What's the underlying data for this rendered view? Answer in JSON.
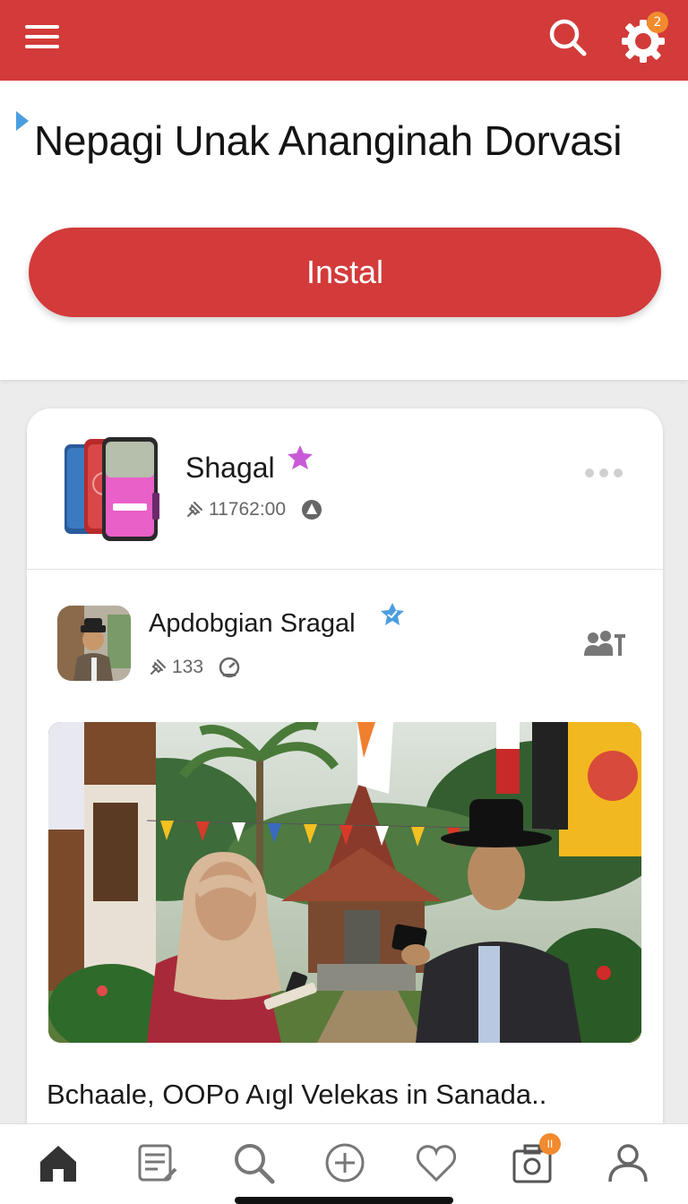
{
  "header": {
    "title": "Nepagi Unak Ananginah Dorvasi",
    "install_label": "Instal",
    "settings_badge": "2"
  },
  "app": {
    "name": "Shagal",
    "stats": "11762:00"
  },
  "post": {
    "author": "Apdobgian Sragal",
    "stats": "133",
    "caption": "Bchaale, OOPo Aıgl Velekas in Sanada.."
  },
  "bottom_nav": {
    "items": [
      "home",
      "notes",
      "search",
      "add",
      "favorites",
      "camera",
      "profile"
    ],
    "camera_badge": "II"
  },
  "colors": {
    "brand_red": "#d33a3a",
    "badge_orange": "#f28a2e",
    "star_purple": "#c85ad8",
    "verified_blue": "#4a9ee0"
  }
}
